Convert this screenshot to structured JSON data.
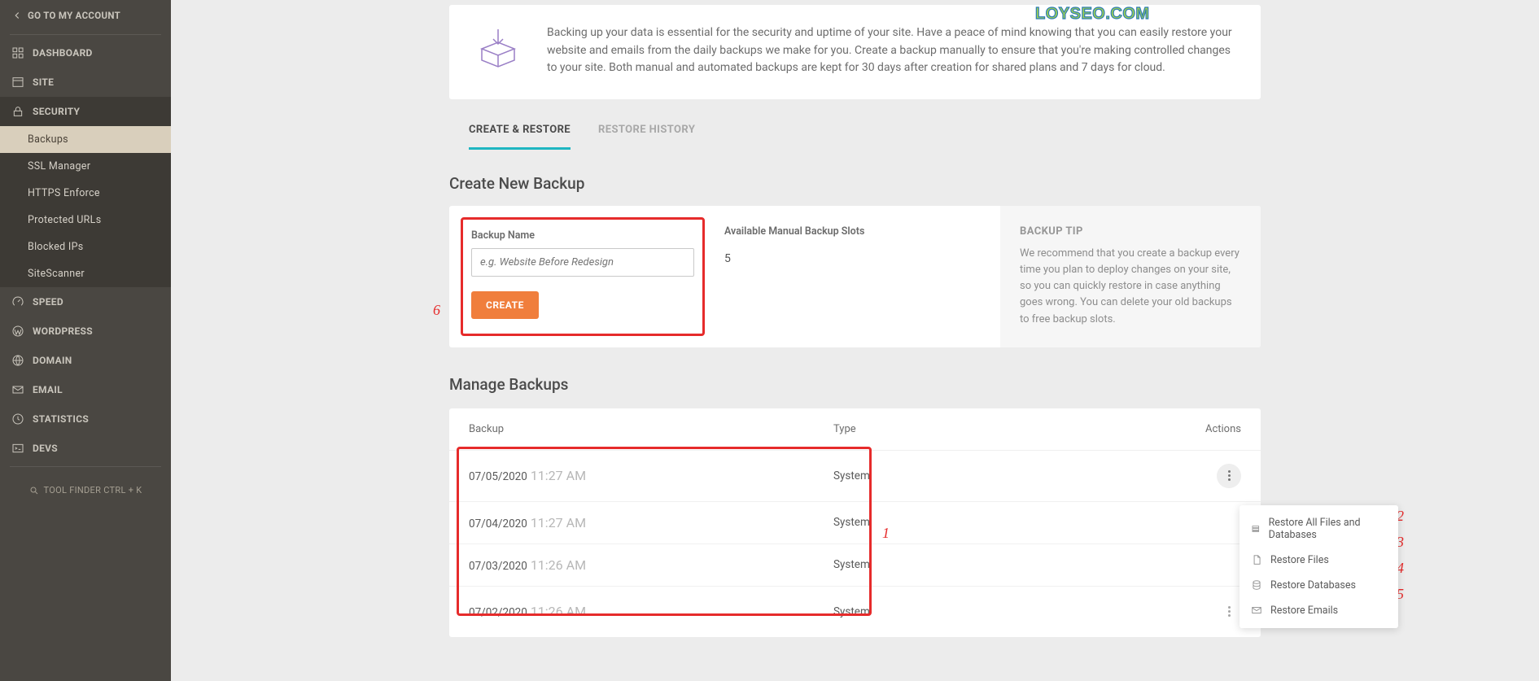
{
  "watermark": "LOYSEO.COM",
  "sidebar": {
    "go_account": "GO TO MY ACCOUNT",
    "items": [
      {
        "label": "DASHBOARD"
      },
      {
        "label": "SITE"
      },
      {
        "label": "SECURITY"
      },
      {
        "label": "SPEED"
      },
      {
        "label": "WORDPRESS"
      },
      {
        "label": "DOMAIN"
      },
      {
        "label": "EMAIL"
      },
      {
        "label": "STATISTICS"
      },
      {
        "label": "DEVS"
      }
    ],
    "security_sub": [
      {
        "label": "Backups"
      },
      {
        "label": "SSL Manager"
      },
      {
        "label": "HTTPS Enforce"
      },
      {
        "label": "Protected URLs"
      },
      {
        "label": "Blocked IPs"
      },
      {
        "label": "SiteScanner"
      }
    ],
    "tool_finder": "TOOL FINDER CTRL + K"
  },
  "intro": {
    "text": "Backing up your data is essential for the security and uptime of your site. Have a peace of mind knowing that you can easily restore your website and emails from the daily backups we make for you. Create a backup manually to ensure that you're making controlled changes to your site. Both manual and automated backups are kept for 30 days after creation for shared plans and 7 days for cloud."
  },
  "tabs": {
    "create_restore": "CREATE & RESTORE",
    "restore_history": "RESTORE HISTORY"
  },
  "create": {
    "title": "Create New Backup",
    "name_label": "Backup Name",
    "placeholder": "e.g. Website Before Redesign",
    "button": "CREATE",
    "slots_label": "Available Manual Backup Slots",
    "slots_value": "5",
    "tip_title": "BACKUP TIP",
    "tip_text": "We recommend that you create a backup every time you plan to deploy changes on your site, so you can quickly restore in case anything goes wrong. You can delete your old backups to free backup slots."
  },
  "manage": {
    "title": "Manage Backups",
    "col_backup": "Backup",
    "col_type": "Type",
    "col_actions": "Actions",
    "rows": [
      {
        "date": "07/05/2020",
        "time": "11:27 AM",
        "type": "System"
      },
      {
        "date": "07/04/2020",
        "time": "11:27 AM",
        "type": "System"
      },
      {
        "date": "07/03/2020",
        "time": "11:26 AM",
        "type": "System"
      },
      {
        "date": "07/02/2020",
        "time": "11:26 AM",
        "type": "System"
      }
    ]
  },
  "popup": {
    "items": [
      {
        "label": "Restore All Files and Databases"
      },
      {
        "label": "Restore Files"
      },
      {
        "label": "Restore Databases"
      },
      {
        "label": "Restore Emails"
      }
    ]
  },
  "annotations": {
    "n1": "1",
    "n2": "2",
    "n3": "3",
    "n4": "4",
    "n5": "5",
    "n6": "6"
  }
}
